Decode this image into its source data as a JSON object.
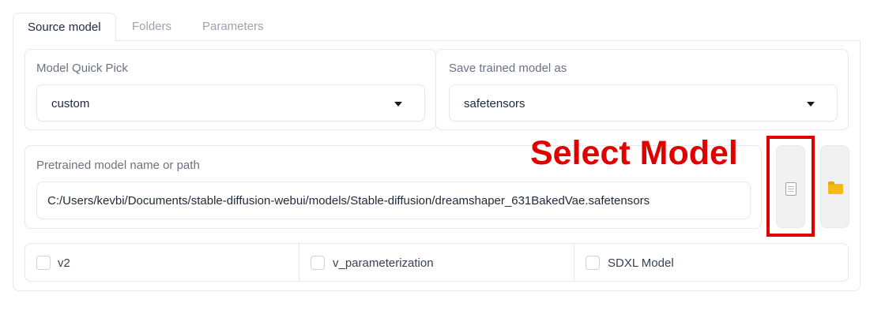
{
  "tabs": [
    {
      "label": "Source model",
      "active": true
    },
    {
      "label": "Folders",
      "active": false
    },
    {
      "label": "Parameters",
      "active": false
    }
  ],
  "model_quick_pick": {
    "label": "Model Quick Pick",
    "value": "custom"
  },
  "save_as": {
    "label": "Save trained model as",
    "value": "safetensors"
  },
  "pretrained": {
    "label": "Pretrained model name or path",
    "value": "C:/Users/kevbi/Documents/stable-diffusion-webui/models/Stable-diffusion/dreamshaper_631BakedVae.safetensors"
  },
  "buttons": {
    "file_icon": "document-icon",
    "folder_icon": "folder-icon"
  },
  "checkboxes": [
    {
      "label": "v2",
      "checked": false
    },
    {
      "label": "v_parameterization",
      "checked": false
    },
    {
      "label": "SDXL Model",
      "checked": false
    }
  ],
  "annotation": {
    "text": "Select Model",
    "color": "#e00000"
  }
}
